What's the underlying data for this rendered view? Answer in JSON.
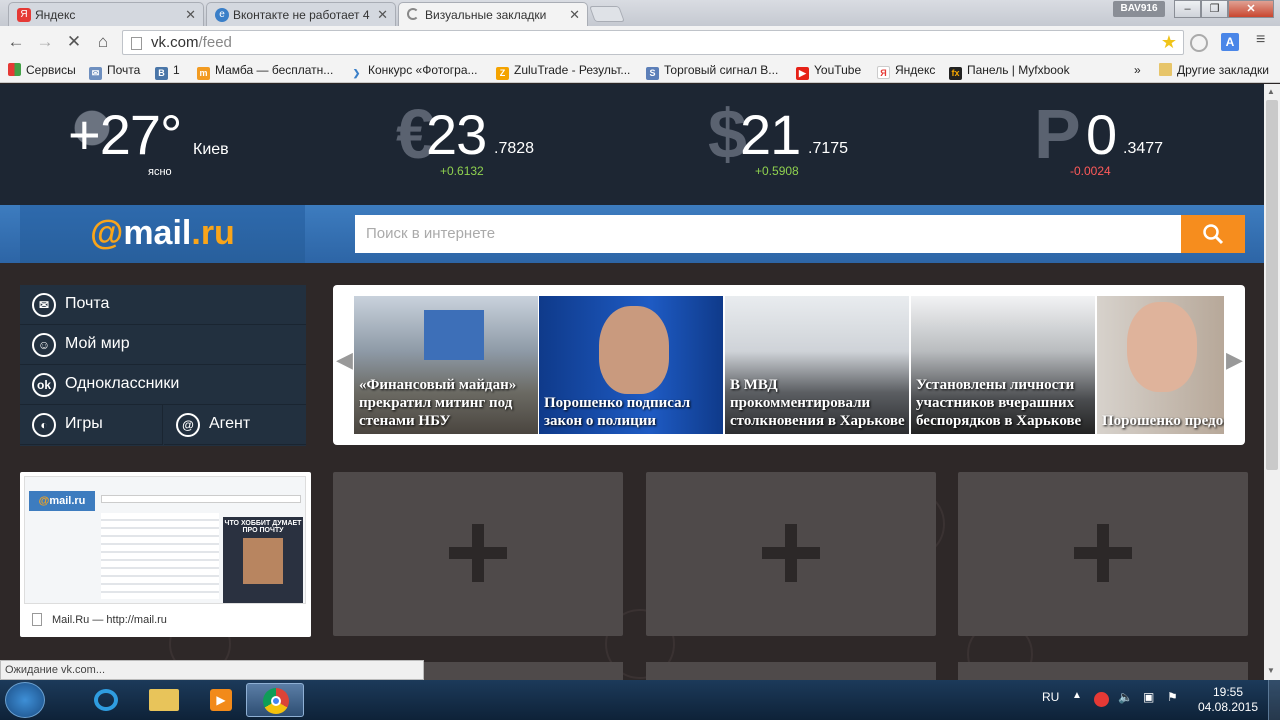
{
  "browser": {
    "tabs": [
      {
        "label": "Яндекс",
        "icon": "yandex-icon"
      },
      {
        "label": "Вконтакте не работает 4",
        "icon": "globe-icon"
      },
      {
        "label": "Визуальные закладки",
        "icon": "loading-icon"
      }
    ],
    "user_badge": "BAV916",
    "url_domain": "vk.com",
    "url_path": "/feed",
    "bookmarks": [
      {
        "label": "Сервисы"
      },
      {
        "label": "Почта"
      },
      {
        "label": "1"
      },
      {
        "label": "Мамба — бесплатн..."
      },
      {
        "label": "Конкурс «Фотогра..."
      },
      {
        "label": "ZuluTrade - Результ..."
      },
      {
        "label": "Торговый сигнал В..."
      },
      {
        "label": "YouTube"
      },
      {
        "label": "Яндекс"
      },
      {
        "label": "Панель | Myfxbook"
      }
    ],
    "bookmarks_more": "»",
    "other_bookmarks": "Другие закладки",
    "status": "Ожидание vk.com..."
  },
  "weather": {
    "temp": "+27°",
    "city": "Киев",
    "condition": "ясно"
  },
  "rates": [
    {
      "symbol": "€",
      "whole": "23",
      "frac": ".7828",
      "change": "+0.6132",
      "direction": "up"
    },
    {
      "symbol": "$",
      "whole": "21",
      "frac": ".7175",
      "change": "+0.5908",
      "direction": "up"
    },
    {
      "symbol": "Р",
      "whole": "0",
      "frac": ".3477",
      "change": "-0.0024",
      "direction": "down"
    }
  ],
  "mailru": {
    "logo_at": "@",
    "logo_mail": "mail",
    "logo_ru": ".ru",
    "search_placeholder": "Поиск в интернете"
  },
  "menu": {
    "mail": "Почта",
    "myworld": "Мой мир",
    "ok": "Одноклассники",
    "games": "Игры",
    "agent": "Агент"
  },
  "news": [
    {
      "caption": "«Финансовый майдан» прекратил митинг под стенами НБУ"
    },
    {
      "caption": "Порошенко подписал закон о полиции"
    },
    {
      "caption": "В МВД прокомментировали столкновения в Харькове"
    },
    {
      "caption": "Установлены личности участников вчерашних беспорядков в Харькове"
    },
    {
      "caption": "Порошенко предоставил Ма Гайдар украинск гражданство"
    }
  ],
  "speed_dial": {
    "thumb_title": "Mail.Ru — http://mail.ru",
    "thumb_ad": "ЧТО ХОББИТ ДУМАЕТ ПРО ПОЧТУ"
  },
  "taskbar": {
    "lang": "RU",
    "time": "19:55",
    "date": "04.08.2015"
  },
  "colors": {
    "accent_orange": "#f68d1e",
    "mailru_blue": "#2d65a6",
    "rate_up": "#8fd14f",
    "rate_down": "#ff5a5a"
  }
}
